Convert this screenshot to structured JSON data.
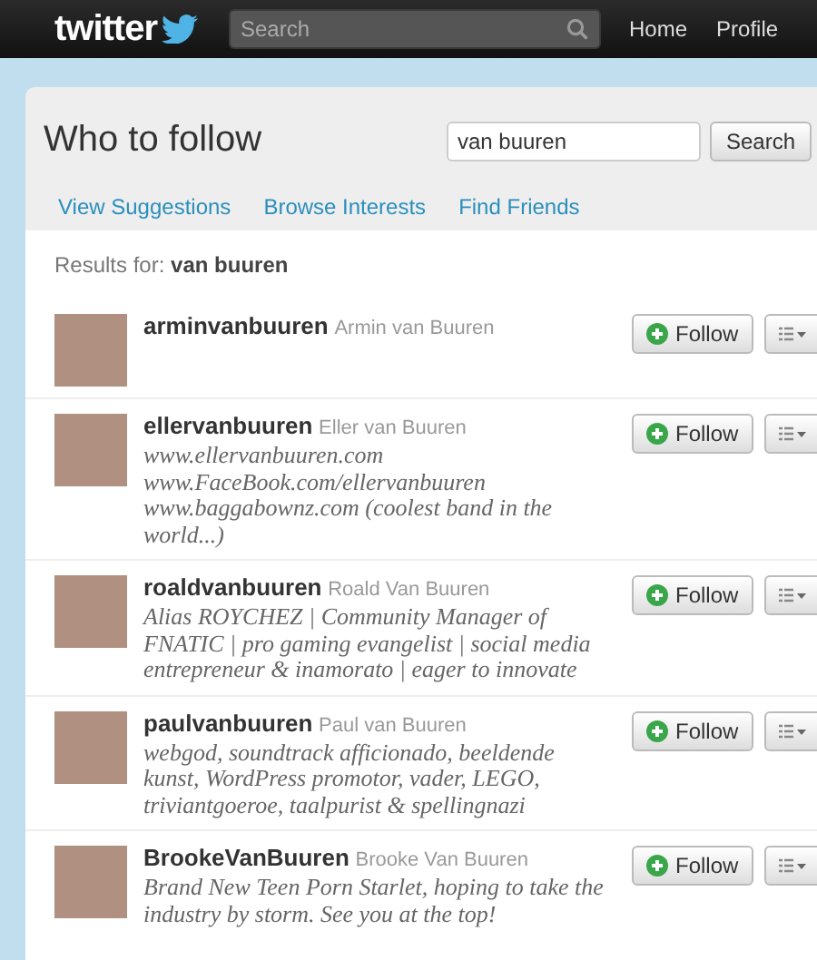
{
  "topbar": {
    "logo": "twitter",
    "search": {
      "placeholder": "Search"
    },
    "nav": [
      "Home",
      "Profile"
    ]
  },
  "page": {
    "title": "Who to follow",
    "search": {
      "value": "van buuren",
      "button": "Search"
    },
    "tabs": [
      {
        "label": "View Suggestions"
      },
      {
        "label": "Browse Interests"
      },
      {
        "label": "Find Friends"
      }
    ],
    "results_label": "Results for:",
    "query": "van buuren",
    "users": [
      {
        "username": "arminvanbuuren",
        "name": "Armin van Buuren",
        "follow": "Follow"
      },
      {
        "username": "ellervanbuuren",
        "name": "Eller van Buuren",
        "bio": "www.ellervanbuuren.com www.FaceBook.com/ellervanbuuren www.baggabownz.com (coolest band in the world...)",
        "follow": "Follow"
      },
      {
        "username": "roaldvanbuuren",
        "name": "Roald Van Buuren",
        "bio": "Alias ROYCHEZ | Community Manager of FNATIC | pro gaming evangelist | social media entrepreneur & inamorato | eager to innovate",
        "follow": "Follow"
      },
      {
        "username": "paulvanbuuren",
        "name": "Paul van Buuren",
        "bio": "webgod, soundtrack afficionado, beeldende kunst, WordPress promotor, vader, LEGO, triviantgoeroe, taalpurist & spellingnazi",
        "follow": "Follow"
      },
      {
        "username": "BrookeVanBuuren",
        "name": "Brooke Van Buuren",
        "bio": "Brand New Teen Porn Starlet, hoping to take the industry by storm. See you at the top!",
        "follow": "Follow"
      }
    ]
  }
}
